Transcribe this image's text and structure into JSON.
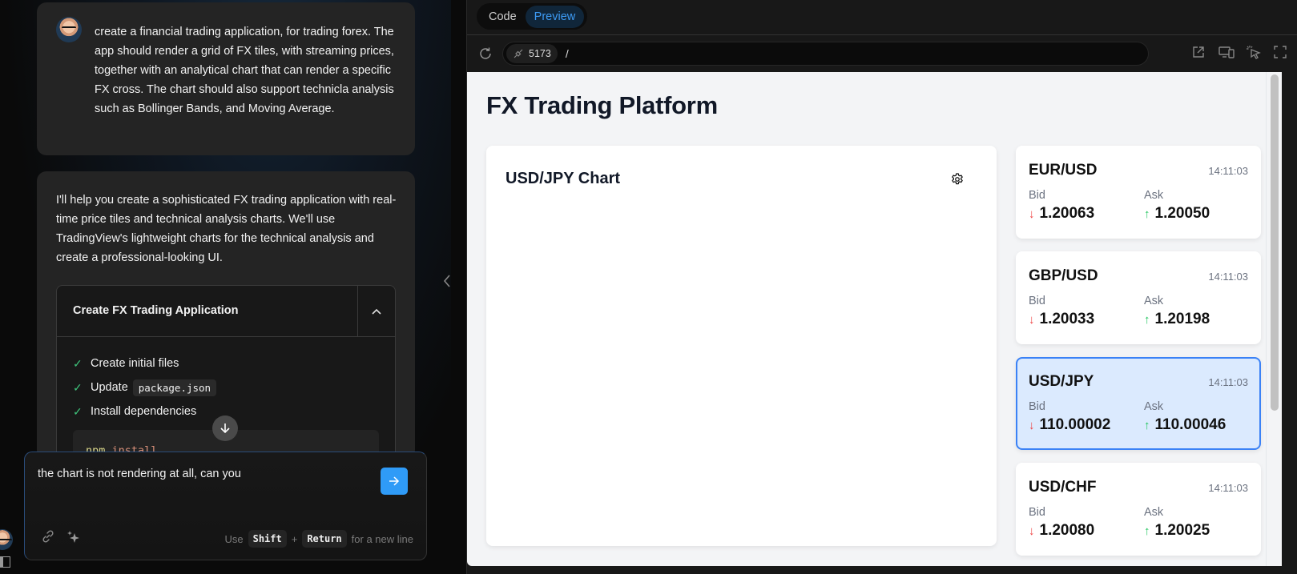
{
  "chat": {
    "user_message": "create a financial trading application, for trading forex. The app should render a grid of FX tiles, with streaming prices, together with an analytical chart that can render a specific FX cross. The chart should also support technicla analysis such as Bollinger Bands, and Moving Average.",
    "assistant_message": "I'll help you create a sophisticated FX trading application with real-time price tiles and technical analysis charts. We'll use TradingView's lightweight charts for the technical analysis and create a professional-looking UI.",
    "artifact": {
      "title": "Create FX Trading Application",
      "steps": [
        {
          "label": "Create initial files",
          "code": ""
        },
        {
          "label": "Update",
          "code": "package.json"
        },
        {
          "label": "Install dependencies",
          "code": ""
        }
      ],
      "command": {
        "cmd": "npm",
        "arg": "install"
      }
    },
    "input": {
      "value": "the chart is not rendering at all, can you",
      "hint_use": "Use",
      "hint_key1": "Shift",
      "hint_plus": "+",
      "hint_key2": "Return",
      "hint_suffix": "for a new line"
    }
  },
  "preview": {
    "tabs": [
      {
        "label": "Code",
        "active": false
      },
      {
        "label": "Preview",
        "active": true
      }
    ],
    "port": "5173",
    "path": "/",
    "app": {
      "title": "FX Trading Platform",
      "chart_title": "USD/JPY Chart",
      "tiles": [
        {
          "pair": "EUR/USD",
          "time": "14:11:03",
          "bid_label": "Bid",
          "bid": "1.20063",
          "bid_dir": "down",
          "ask_label": "Ask",
          "ask": "1.20050",
          "ask_dir": "up",
          "selected": false
        },
        {
          "pair": "GBP/USD",
          "time": "14:11:03",
          "bid_label": "Bid",
          "bid": "1.20033",
          "bid_dir": "down",
          "ask_label": "Ask",
          "ask": "1.20198",
          "ask_dir": "up",
          "selected": false
        },
        {
          "pair": "USD/JPY",
          "time": "14:11:03",
          "bid_label": "Bid",
          "bid": "110.00002",
          "bid_dir": "down",
          "ask_label": "Ask",
          "ask": "110.00046",
          "ask_dir": "up",
          "selected": true
        },
        {
          "pair": "USD/CHF",
          "time": "14:11:03",
          "bid_label": "Bid",
          "bid": "1.20080",
          "bid_dir": "down",
          "ask_label": "Ask",
          "ask": "1.20025",
          "ask_dir": "up",
          "selected": false
        }
      ]
    }
  },
  "colors": {
    "accent": "#2f9bf7",
    "selected_tile_bg": "#dbeafe",
    "selected_tile_border": "#3b82f6",
    "price_down": "#ef4444",
    "price_up": "#22c55e"
  }
}
